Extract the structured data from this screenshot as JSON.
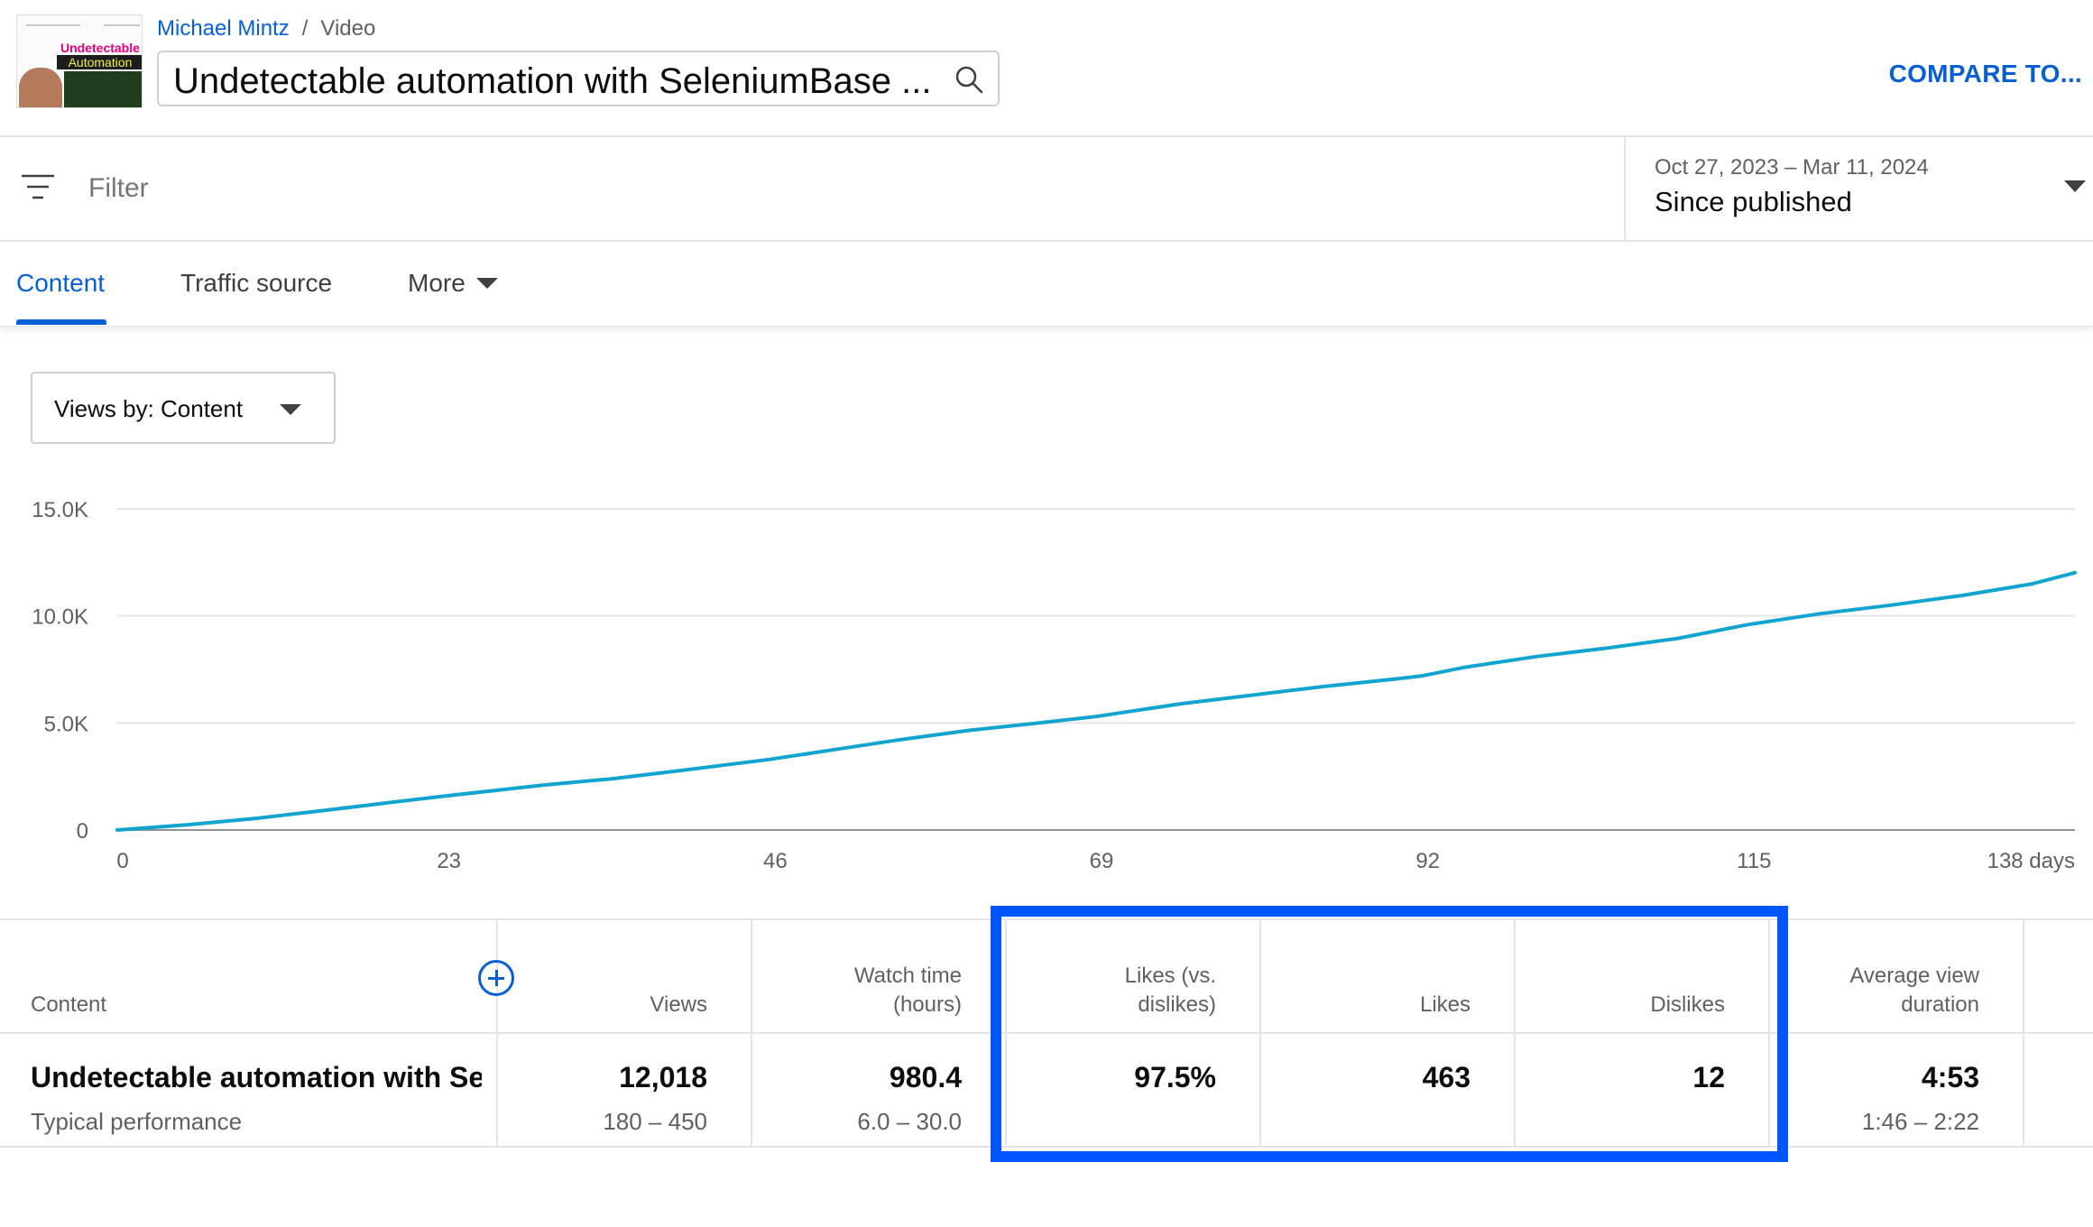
{
  "header": {
    "breadcrumb_channel": "Michael Mintz",
    "breadcrumb_separator": "/",
    "breadcrumb_page": "Video",
    "video_title": "Undetectable automation with SeleniumBase ...",
    "compare_label": "COMPARE TO...",
    "thumbnail_text_1": "Undetectable",
    "thumbnail_text_2": "Automation"
  },
  "filter": {
    "placeholder": "Filter",
    "date_range": "Oct 27, 2023 – Mar 11, 2024",
    "date_label": "Since published"
  },
  "tabs": [
    {
      "label": "Content",
      "active": true
    },
    {
      "label": "Traffic source",
      "active": false
    },
    {
      "label": "More",
      "active": false
    }
  ],
  "views_select": {
    "label": "Views by: Content"
  },
  "chart_data": {
    "type": "line",
    "title": "",
    "xlabel": "",
    "ylabel": "",
    "x_ticks": [
      "0",
      "23",
      "46",
      "69",
      "92",
      "115",
      "138 days"
    ],
    "x_tick_values": [
      0,
      23,
      46,
      69,
      92,
      115,
      138
    ],
    "y_ticks": [
      "0",
      "5.0K",
      "10.0K",
      "15.0K"
    ],
    "y_tick_values": [
      0,
      5000,
      10000,
      15000
    ],
    "xlim": [
      0,
      138
    ],
    "ylim": [
      0,
      15000
    ],
    "grid": true,
    "line_color": "#12a4d0",
    "series": [
      {
        "x": [
          0,
          5,
          10,
          15,
          20,
          23,
          30,
          35,
          40,
          46,
          50,
          55,
          60,
          65,
          69,
          75,
          80,
          85,
          90,
          92,
          95,
          100,
          105,
          110,
          115,
          120,
          125,
          130,
          135,
          138
        ],
        "y": [
          0,
          250,
          560,
          950,
          1350,
          1580,
          2100,
          2400,
          2800,
          3300,
          3700,
          4200,
          4650,
          5000,
          5300,
          5900,
          6300,
          6700,
          7050,
          7200,
          7600,
          8100,
          8500,
          8950,
          9600,
          10100,
          10500,
          10950,
          11500,
          12018
        ]
      }
    ]
  },
  "table": {
    "headers": {
      "content": "Content",
      "views": "Views",
      "watch_time_1": "Watch time",
      "watch_time_2": "(hours)",
      "likes_vs_1": "Likes (vs.",
      "likes_vs_2": "dislikes)",
      "likes": "Likes",
      "dislikes": "Dislikes",
      "avg_view_1": "Average view",
      "avg_view_2": "duration"
    },
    "row": {
      "content": "Undetectable automation with Se...",
      "content_sub": "Typical performance",
      "views": "12,018",
      "views_sub": "180 – 450",
      "watch_time": "980.4",
      "watch_time_sub": "6.0 – 30.0",
      "likes_vs": "97.5%",
      "likes": "463",
      "dislikes": "12",
      "avg_view": "4:53",
      "avg_view_sub": "1:46 – 2:22"
    }
  },
  "colors": {
    "accent": "#065fd4",
    "highlight": "#0055ff",
    "chart_line": "#12a4d0"
  }
}
